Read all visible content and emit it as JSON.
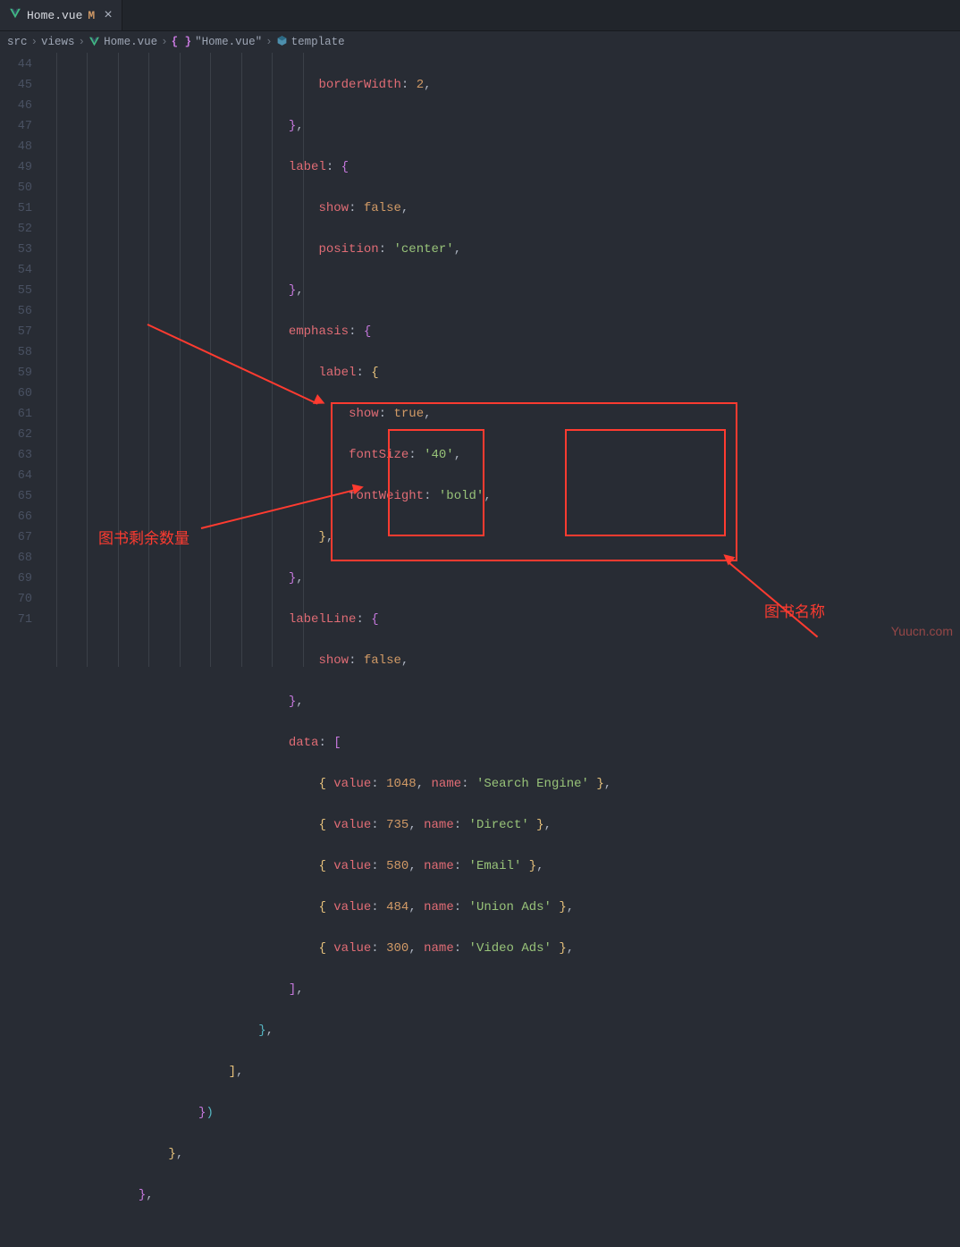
{
  "tab": {
    "filename": "Home.vue",
    "modified_marker": "M"
  },
  "breadcrumb": {
    "src": "src",
    "views": "views",
    "file": "Home.vue",
    "scope": "\"Home.vue\"",
    "template": "template"
  },
  "lines": {
    "start": 44,
    "end": 71
  },
  "code": {
    "l44": {
      "prop": "borderWidth",
      "val": "2"
    },
    "l46": {
      "prop": "label"
    },
    "l47": {
      "prop": "show",
      "val": "false"
    },
    "l48": {
      "prop": "position",
      "val": "'center'"
    },
    "l50": {
      "prop": "emphasis"
    },
    "l51": {
      "prop": "label"
    },
    "l52": {
      "prop": "show",
      "val": "true"
    },
    "l53": {
      "prop": "fontSize",
      "val": "'40'"
    },
    "l54": {
      "prop": "fontWeight",
      "val": "'bold'"
    },
    "l57": {
      "prop": "labelLine"
    },
    "l58": {
      "prop": "show",
      "val": "false"
    },
    "l60": {
      "prop": "data"
    },
    "rows": [
      {
        "value": "1048",
        "name": "'Search Engine'"
      },
      {
        "value": "735",
        "name": "'Direct'"
      },
      {
        "value": "580",
        "name": "'Email'"
      },
      {
        "value": "484",
        "name": "'Union Ads'"
      },
      {
        "value": "300",
        "name": "'Video Ads'"
      }
    ],
    "kw_value": "value",
    "kw_name": "name"
  },
  "annotations": {
    "values_label": "图书剩余数量",
    "names_label": "图书名称"
  },
  "watermark": "Yuucn.com",
  "chart_data": {
    "type": "pie",
    "title": "",
    "series": [
      {
        "name": "Search Engine",
        "value": 1048
      },
      {
        "name": "Direct",
        "value": 735
      },
      {
        "name": "Email",
        "value": 580
      },
      {
        "name": "Union Ads",
        "value": 484
      },
      {
        "name": "Video Ads",
        "value": 300
      }
    ]
  }
}
